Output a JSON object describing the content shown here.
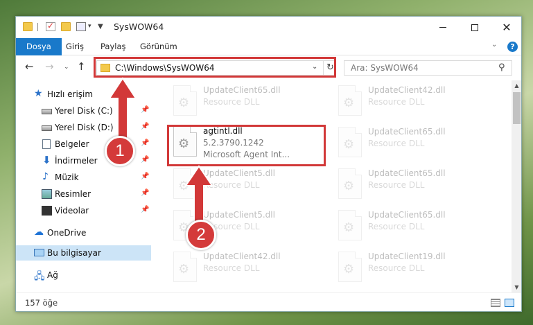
{
  "window": {
    "title": "SysWOW64",
    "controls": {
      "minimize": "",
      "maximize": "",
      "close": "✕"
    }
  },
  "ribbon": {
    "tabs": [
      {
        "label": "Dosya",
        "active": true
      },
      {
        "label": "Giriş"
      },
      {
        "label": "Paylaş"
      },
      {
        "label": "Görünüm"
      }
    ],
    "help": "?"
  },
  "navigation": {
    "back": "←",
    "forward": "→",
    "recent": "⌄",
    "up": "↑",
    "address": "C:\\Windows\\SysWOW64",
    "refresh": "↻",
    "search_placeholder": "Ara: SysWOW64"
  },
  "sidebar": {
    "items": [
      {
        "label": "Hızlı erişim",
        "icon": "star-icon",
        "pinned": false
      },
      {
        "label": "Yerel Disk (C:)",
        "icon": "disk-icon",
        "pinned": true
      },
      {
        "label": "Yerel Disk (D:)",
        "icon": "disk-icon",
        "pinned": true
      },
      {
        "label": "Belgeler",
        "icon": "documents-icon",
        "pinned": true
      },
      {
        "label": "İndirmeler",
        "icon": "download-icon",
        "pinned": true
      },
      {
        "label": "Müzik",
        "icon": "music-icon",
        "pinned": true
      },
      {
        "label": "Resimler",
        "icon": "pictures-icon",
        "pinned": true
      },
      {
        "label": "Videolar",
        "icon": "video-icon",
        "pinned": true
      },
      {
        "label": "OneDrive",
        "icon": "cloud-icon"
      },
      {
        "label": "Bu bilgisayar",
        "icon": "computer-icon",
        "selected": true
      },
      {
        "label": "Ağ",
        "icon": "network-icon"
      }
    ]
  },
  "files": {
    "highlighted": {
      "name": "agtintl.dll",
      "version": "5.2.3790.1242",
      "company": "Microsoft Agent Int..."
    },
    "col1": [
      {
        "name": "UpdateClient65.dll",
        "type": "Resource DLL"
      },
      {
        "name": "UpdateClient5.dll",
        "type": "Resource DLL"
      },
      {
        "name": "UpdateClient5.dll",
        "type": "Resource DLL"
      },
      {
        "name": "UpdateClient42.dll",
        "type": "Resource DLL"
      }
    ],
    "col2": [
      {
        "name": "UpdateClient42.dll",
        "type": "Resource DLL"
      },
      {
        "name": "UpdateClient65.dll",
        "type": "Resource DLL"
      },
      {
        "name": "UpdateClient65.dll",
        "type": "Resource DLL"
      },
      {
        "name": "UpdateClient65.dll",
        "type": "Resource DLL"
      },
      {
        "name": "UpdateClient19.dll",
        "type": "Resource DLL"
      }
    ]
  },
  "status": {
    "count": "157 öğe"
  },
  "annotations": {
    "step1": "1",
    "step2": "2"
  },
  "colors": {
    "accent": "#1979ca",
    "annotation": "#d23838"
  }
}
